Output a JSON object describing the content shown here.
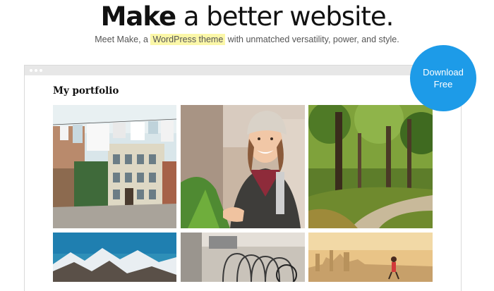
{
  "hero": {
    "title_bold": "Make",
    "title_rest": "a better website.",
    "subtitle_before": "Meet Make, a",
    "subtitle_highlight": "WordPress theme",
    "subtitle_after": "with unmatched versatility, power, and style."
  },
  "cta": {
    "line1": "Download",
    "line2": "Free",
    "color": "#1d9be8"
  },
  "portfolio": {
    "title": "My portfolio",
    "tiles": [
      {
        "name": "photo-street-laundry"
      },
      {
        "name": "photo-woman-beanie"
      },
      {
        "name": "photo-forest-path"
      },
      {
        "name": "photo-snowy-mountains"
      },
      {
        "name": "photo-bicycle-rack"
      },
      {
        "name": "photo-runner-sunset"
      }
    ]
  }
}
